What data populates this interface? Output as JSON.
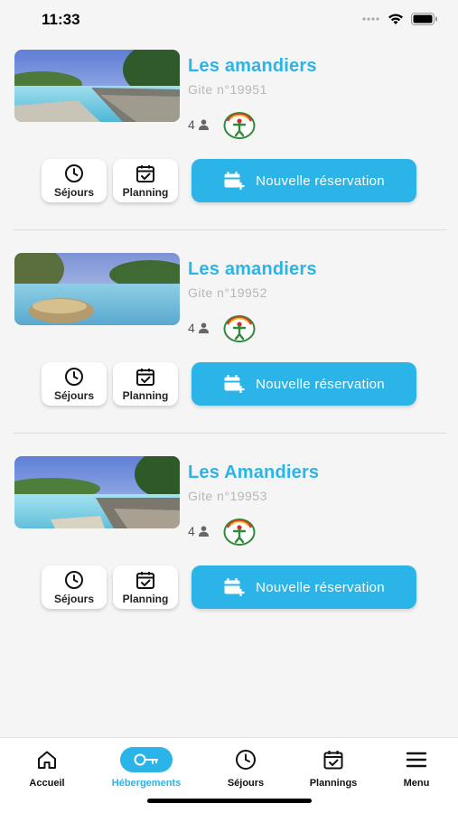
{
  "status": {
    "time": "11:33"
  },
  "listings": [
    {
      "title": "Les amandiers",
      "subtitle": "Gite n°19951",
      "capacity": "4",
      "btn_sejours": "Séjours",
      "btn_planning": "Planning",
      "btn_new": "Nouvelle réservation"
    },
    {
      "title": "Les amandiers",
      "subtitle": "Gite n°19952",
      "capacity": "4",
      "btn_sejours": "Séjours",
      "btn_planning": "Planning",
      "btn_new": "Nouvelle réservation"
    },
    {
      "title": "Les Amandiers",
      "subtitle": "Gite n°19953",
      "capacity": "4",
      "btn_sejours": "Séjours",
      "btn_planning": "Planning",
      "btn_new": "Nouvelle réservation"
    }
  ],
  "tabbar": {
    "items": [
      {
        "label": "Accueil",
        "icon": "home-icon"
      },
      {
        "label": "Hébergements",
        "icon": "key-icon",
        "active": true
      },
      {
        "label": "Séjours",
        "icon": "clock-icon"
      },
      {
        "label": "Plannings",
        "icon": "calendar-check-icon"
      },
      {
        "label": "Menu",
        "icon": "menu-icon"
      }
    ]
  },
  "colors": {
    "accent": "#2ab4e8",
    "background": "#f5f5f5"
  }
}
